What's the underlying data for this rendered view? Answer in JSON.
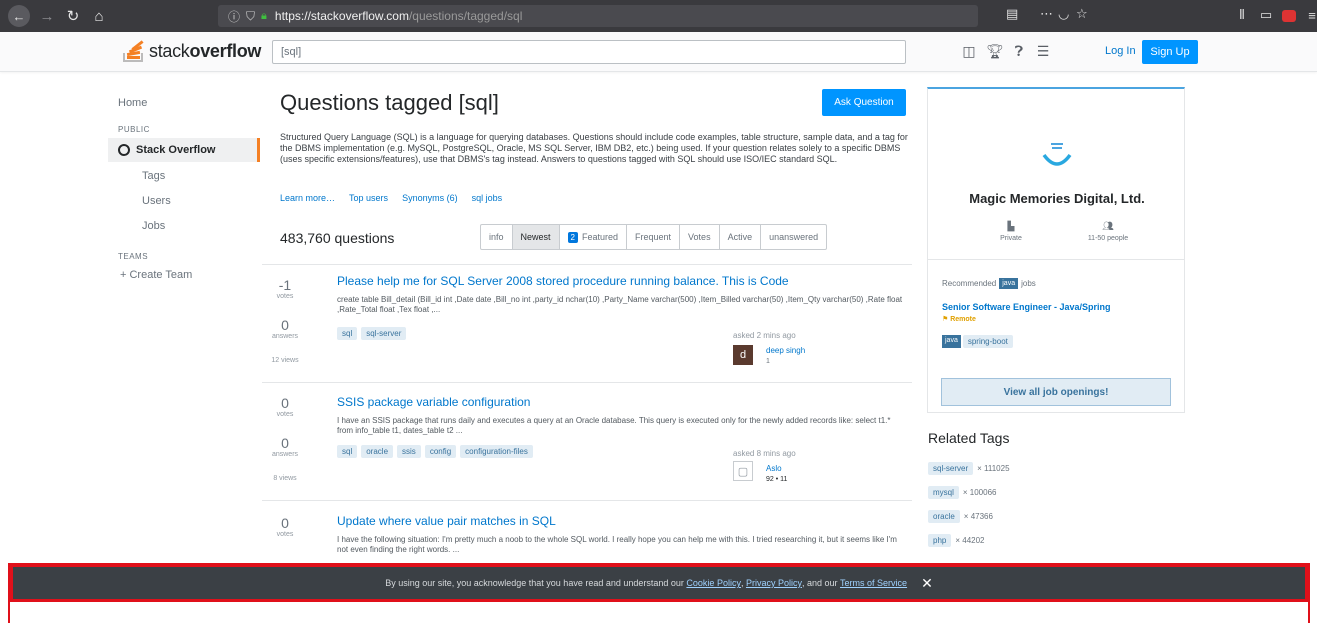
{
  "browser": {
    "url_host": "https://stackoverflow.com",
    "url_path": "/questions/tagged/sql"
  },
  "header": {
    "brand_light": "stack",
    "brand_bold": "overflow",
    "search_value": "[sql]",
    "login": "Log In",
    "signup": "Sign Up"
  },
  "leftnav": {
    "home": "Home",
    "public": "PUBLIC",
    "stack_overflow": "Stack Overflow",
    "tags": "Tags",
    "users": "Users",
    "jobs": "Jobs",
    "teams": "TEAMS",
    "create_team": "+ Create Team"
  },
  "main": {
    "title": "Questions tagged [sql]",
    "ask": "Ask Question",
    "description": "Structured Query Language (SQL) is a language for querying databases. Questions should include code examples, table structure, sample data, and a tag for the DBMS implementation (e.g. MySQL, PostgreSQL, Oracle, MS SQL Server, IBM DB2, etc.) being used. If your question relates solely to a specific DBMS (uses specific extensions/features), use that DBMS's tag instead. Answers to questions tagged with SQL should use ISO/IEC standard SQL.",
    "links": [
      "Learn more…",
      "Top users",
      "Synonyms (6)",
      "sql jobs"
    ],
    "count": "483,760 questions",
    "filters": [
      "info",
      "Newest",
      "Featured",
      "Frequent",
      "Votes",
      "Active",
      "unanswered"
    ],
    "bounty_count": "2"
  },
  "questions": [
    {
      "votes": "-1",
      "votes_lbl": "votes",
      "answers": "0",
      "answers_lbl": "answers",
      "views": "12 views",
      "title": "Please help me for SQL Server 2008 stored procedure running balance. This is Code",
      "excerpt": "create table Bill_detail (Bill_id int ,Date date ,Bill_no int ,party_id nchar(10) ,Party_Name varchar(500) ,Item_Billed varchar(50) ,Item_Qty varchar(50) ,Rate float ,Rate_Total float ,Tex float ,...",
      "tags": [
        "sql",
        "sql-server"
      ],
      "asked": "asked 2 mins ago",
      "user": "deep singh",
      "rep": "1",
      "avatar_letter": "d"
    },
    {
      "votes": "0",
      "votes_lbl": "votes",
      "answers": "0",
      "answers_lbl": "answers",
      "views": "8 views",
      "title": "SSIS package variable configuration",
      "excerpt": "I have an SSIS package that runs daily and executes a query at an Oracle database. This query is executed only for the newly added records like: select t1.* from info_table t1, dates_table t2 ...",
      "tags": [
        "sql",
        "oracle",
        "ssis",
        "config",
        "configuration-files"
      ],
      "asked": "asked 8 mins ago",
      "user": "Aslo",
      "rep": "92 • 11"
    },
    {
      "votes": "0",
      "votes_lbl": "votes",
      "title": "Update where value pair matches in SQL",
      "excerpt": "I have the following situation: I'm pretty much a noob to the whole SQL world. I really hope you can help me with this. I tried researching it, but it seems like I'm not even finding the right words. ..."
    }
  ],
  "company": {
    "name": "Magic Memories Digital, Ltd.",
    "type": "Private",
    "size": "11-50 people",
    "recommended": "Recommended",
    "rec_tag": "java",
    "rec_suffix": "jobs",
    "job_title": "Senior Software Engineer - Java/Spring",
    "remote": "Remote",
    "job_tags": [
      "java",
      "spring-boot"
    ],
    "view_all": "View all job openings!"
  },
  "related": {
    "title": "Related Tags",
    "items": [
      {
        "tag": "sql-server",
        "count": "× 111025"
      },
      {
        "tag": "mysql",
        "count": "× 100066"
      },
      {
        "tag": "oracle",
        "count": "× 47366"
      },
      {
        "tag": "php",
        "count": "× 44202"
      }
    ]
  },
  "cookie": {
    "text": "By using our site, you acknowledge that you have read and understand our",
    "cookie_policy": "Cookie Policy",
    "privacy_policy": "Privacy Policy",
    "and_our": ", and our",
    "terms": "Terms of Service",
    "close": "✕"
  },
  "colors": {
    "brand_orange": "#f48024",
    "primary_blue": "#0095ff",
    "link_blue": "#0077cc",
    "highlight_red": "#e0101a"
  }
}
